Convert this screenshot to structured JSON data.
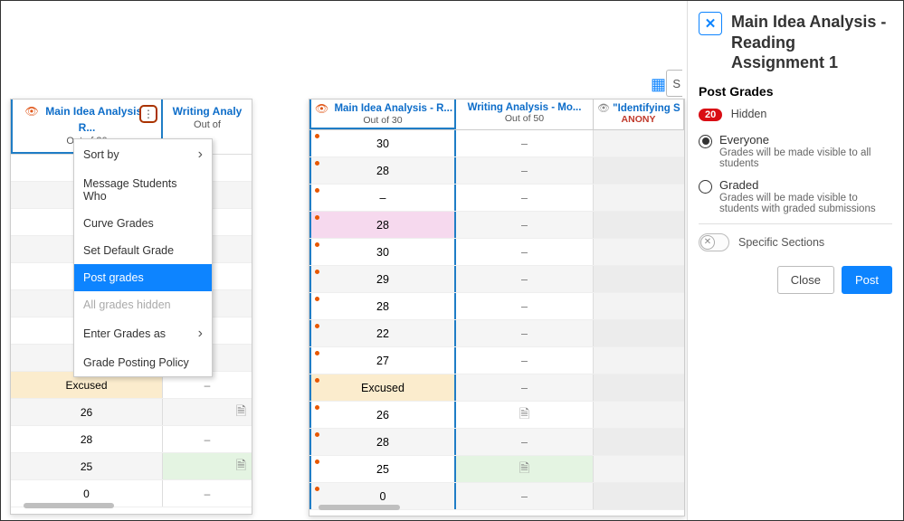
{
  "colors": {
    "blue": "#0d84ff",
    "orange": "#e0581b",
    "red": "#d90d14"
  },
  "left": {
    "col1": {
      "title": "Main Idea Analysis - R...",
      "sub": "Out of 30"
    },
    "col2": {
      "title": "Writing Analy",
      "sub": "Out of"
    },
    "rows": [
      {
        "v": "",
        "r": "–",
        "alt": false
      },
      {
        "v": "",
        "r": "–",
        "alt": true
      },
      {
        "v": "",
        "r": "–",
        "alt": false
      },
      {
        "v": "",
        "r": "–",
        "alt": true
      },
      {
        "v": "",
        "r": "–",
        "alt": false
      },
      {
        "v": "",
        "r": "–",
        "alt": true
      },
      {
        "v": "",
        "r": "–",
        "alt": false
      },
      {
        "v": "",
        "r": "–",
        "alt": true
      },
      {
        "v": "Excused",
        "r": "–",
        "alt": false,
        "excused": true
      },
      {
        "v": "26",
        "r": "",
        "alt": true,
        "doc": true
      },
      {
        "v": "28",
        "r": "–",
        "alt": false
      },
      {
        "v": "25",
        "r": "",
        "alt": true,
        "doc": true,
        "r_green": true
      },
      {
        "v": "0",
        "r": "–",
        "alt": false
      }
    ]
  },
  "dropdown": {
    "items": [
      {
        "label": "Sort by",
        "chev": true
      },
      {
        "label": "Message Students Who"
      },
      {
        "label": "Curve Grades"
      },
      {
        "label": "Set Default Grade"
      },
      {
        "label": "Post grades",
        "selected": true
      },
      {
        "label": "All grades hidden",
        "muted": true
      },
      {
        "label": "Enter Grades as",
        "chev": true
      },
      {
        "label": "Grade Posting Policy"
      }
    ]
  },
  "center": {
    "cols": [
      {
        "title": "Main Idea Analysis - R...",
        "sub": "Out of 30",
        "hidden": true
      },
      {
        "title": "Writing Analysis - Mo...",
        "sub": "Out of 50"
      },
      {
        "title": "\"Identifying S",
        "sub": "ANONY",
        "eye": true
      }
    ],
    "rows": [
      {
        "c1": "30",
        "c2": "–"
      },
      {
        "c1": "28",
        "c2": "–"
      },
      {
        "c1": "–",
        "c2": "–"
      },
      {
        "c1": "28",
        "c2": "–",
        "pink": true
      },
      {
        "c1": "30",
        "c2": "–"
      },
      {
        "c1": "29",
        "c2": "–"
      },
      {
        "c1": "28",
        "c2": "–"
      },
      {
        "c1": "22",
        "c2": "–"
      },
      {
        "c1": "27",
        "c2": "–"
      },
      {
        "c1": "Excused",
        "c2": "–",
        "excused": true
      },
      {
        "c1": "26",
        "c2": "",
        "doc": true
      },
      {
        "c1": "28",
        "c2": "–"
      },
      {
        "c1": "25",
        "c2": "",
        "doc": true,
        "c2green": true
      },
      {
        "c1": "0",
        "c2": "–"
      }
    ]
  },
  "toolbar": {
    "btn_label": "S"
  },
  "sidebar": {
    "title": "Main Idea Analysis - Reading Assignment 1",
    "section": "Post Grades",
    "badge": "20",
    "hidden": "Hidden",
    "opt1": {
      "label": "Everyone",
      "sub": "Grades will be made visible to all students"
    },
    "opt2": {
      "label": "Graded",
      "sub": "Grades will be made visible to students with graded submissions"
    },
    "toggle_label": "Specific Sections",
    "close": "Close",
    "post": "Post"
  }
}
